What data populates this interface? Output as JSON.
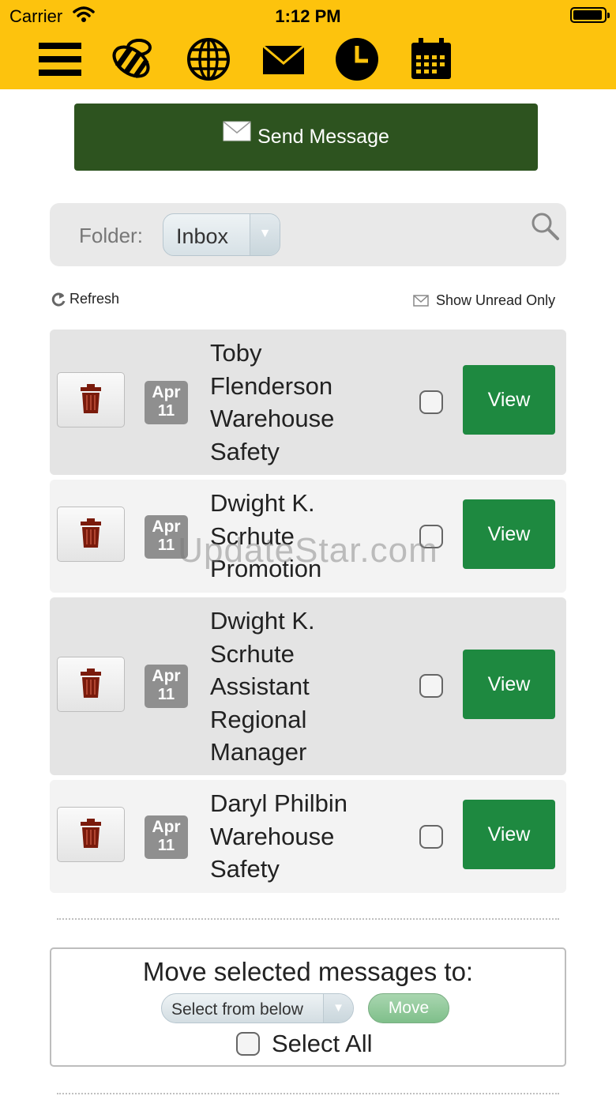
{
  "status_bar": {
    "carrier": "Carrier",
    "time": "1:12 PM"
  },
  "nav_icons": [
    "menu-icon",
    "bee-icon",
    "globe-icon",
    "mail-icon",
    "clock-icon",
    "calendar-icon"
  ],
  "colors": {
    "header": "#fdc30d",
    "send_button": "#2d531f",
    "view_button": "#1e8940"
  },
  "send_button": {
    "label": "Send Message"
  },
  "folder": {
    "label": "Folder:",
    "value": "Inbox"
  },
  "actions": {
    "refresh": "Refresh",
    "show_unread": "Show Unread Only"
  },
  "messages": [
    {
      "month": "Apr",
      "day": "11",
      "lines": [
        "Toby",
        "Flenderson",
        "Warehouse",
        "Safety"
      ],
      "view": "View"
    },
    {
      "month": "Apr",
      "day": "11",
      "lines": [
        "Dwight K.",
        "Scrhute",
        "Promotion"
      ],
      "view": "View"
    },
    {
      "month": "Apr",
      "day": "11",
      "lines": [
        "Dwight K.",
        "Scrhute",
        "Assistant",
        "Regional",
        "Manager"
      ],
      "view": "View"
    },
    {
      "month": "Apr",
      "day": "11",
      "lines": [
        "Daryl Philbin",
        "Warehouse",
        "Safety"
      ],
      "view": "View"
    }
  ],
  "watermark": "UpdateStar.com",
  "move": {
    "title": "Move selected messages to:",
    "select_placeholder": "Select from below",
    "button": "Move",
    "select_all": "Select All"
  }
}
